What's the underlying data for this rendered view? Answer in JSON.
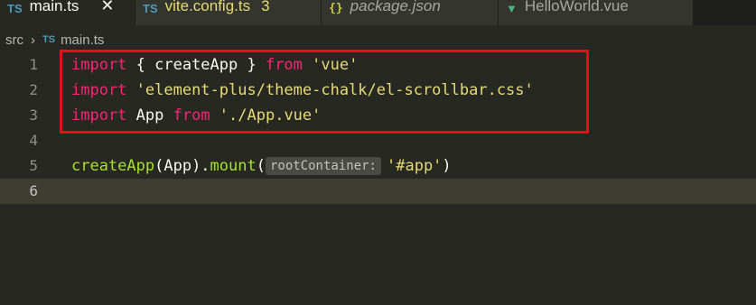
{
  "tabs": [
    {
      "label": "main.ts",
      "icon": "ts-icon",
      "icon_text": "TS",
      "active": true,
      "close": "✕"
    },
    {
      "label": "vite.config.ts",
      "icon": "ts-icon",
      "icon_text": "TS",
      "badge": "3"
    },
    {
      "label": "package.json",
      "icon": "json-icon",
      "icon_text": "{}"
    },
    {
      "label": "HelloWorld.vue",
      "icon": "vue-icon",
      "icon_text": "▼"
    }
  ],
  "breadcrumb": {
    "folder": "src",
    "separator": "›",
    "icon_text": "TS",
    "file": "main.ts"
  },
  "editor": {
    "line_numbers": [
      "1",
      "2",
      "3",
      "4",
      "5",
      "6"
    ],
    "line1": {
      "kw1": "import",
      "p1": " { createApp } ",
      "kw2": "from",
      "str": " 'vue'"
    },
    "line2": {
      "kw": "import",
      "str": " 'element-plus/theme-chalk/el-scrollbar.css'"
    },
    "line3": {
      "kw1": "import",
      "p1": " App ",
      "kw2": "from",
      "str": " './App.vue'"
    },
    "line5": {
      "fn1": "createApp",
      "p1": "(App).",
      "fn2": "mount",
      "p2": "(",
      "hint": "rootContainer:",
      "str": "'#app'",
      "p3": ")"
    }
  },
  "colors": {
    "annotation": "#e0111a",
    "keyword": "#f92672",
    "string": "#e6db74",
    "function": "#a6e22e"
  }
}
